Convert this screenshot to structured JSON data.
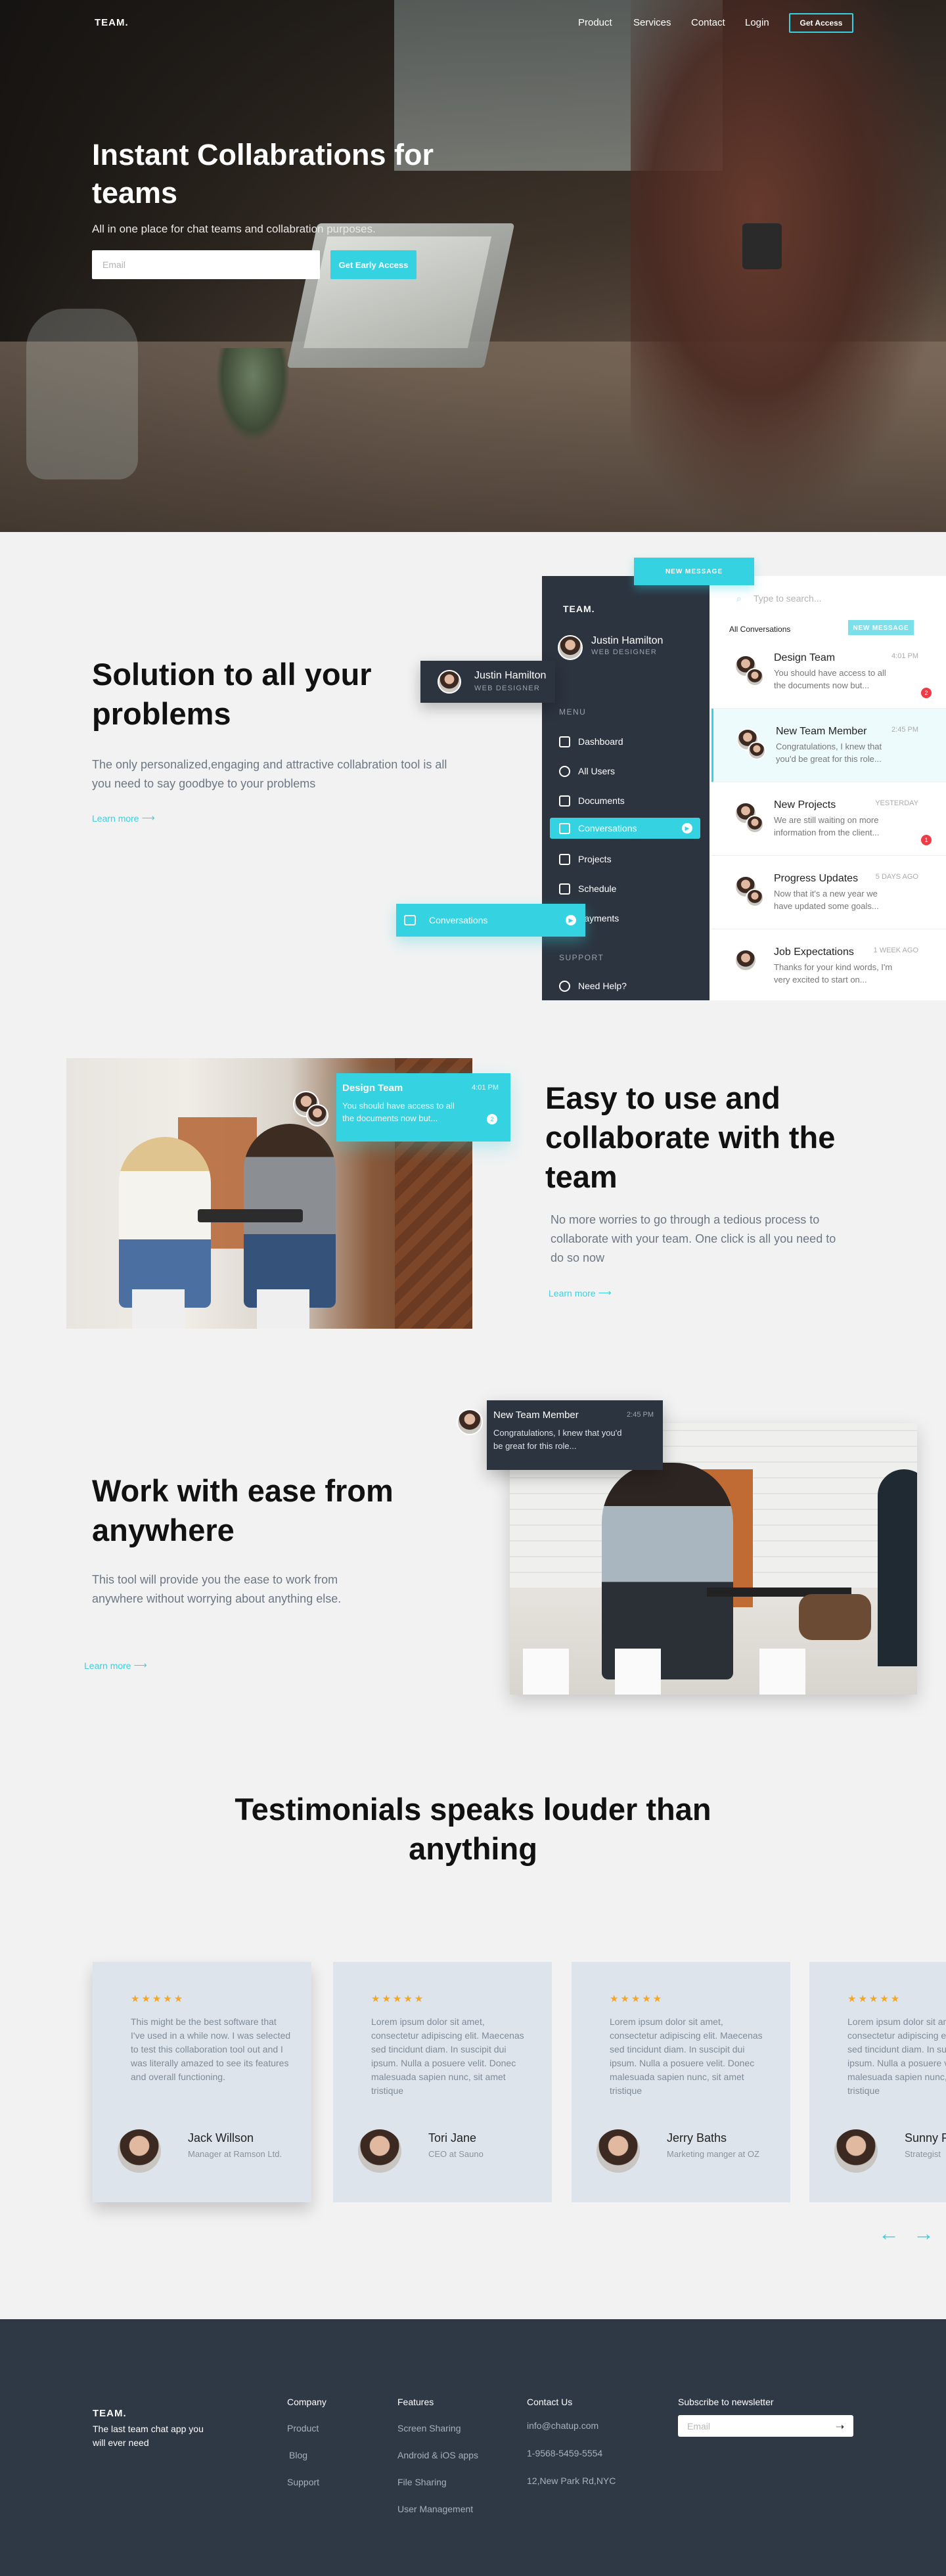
{
  "nav": {
    "logo": "TEAM.",
    "items": [
      "Product",
      "Services",
      "Contact",
      "Login"
    ],
    "cta": "Get Access"
  },
  "hero": {
    "title": "Instant Collabrations for teams",
    "subtitle": "All in one place for chat teams and collabration purposes.",
    "email_placeholder": "Email",
    "cta": "Get Early Access"
  },
  "solution": {
    "title": "Solution to all your problems",
    "text": "The only personalized,engaging and attractive collabration tool is all you need to say  goodbye to your problems",
    "learn_more": "Learn more",
    "new_message_button": "NEW MESSAGE",
    "floating_user": {
      "name": "Justin Hamilton",
      "role": "WEB DESIGNER"
    },
    "floating_conversations": "Conversations",
    "app": {
      "logo": "TEAM.",
      "user": {
        "name": "Justin Hamilton",
        "role": "WEB DESIGNER"
      },
      "menu_heading": "MENU",
      "menu": [
        "Dashboard",
        "All Users",
        "Documents",
        "Conversations",
        "Projects",
        "Schedule",
        "Payments"
      ],
      "support_heading": "SUPPORT",
      "support": [
        "Need Help?"
      ],
      "search_placeholder": "Type to search...",
      "tab_all": "All Conversations",
      "tab_new": "NEW MESSAGE",
      "conversations": [
        {
          "title": "Design Team",
          "time": "4:01 PM",
          "message": "You should have access to all the documents now but...",
          "badge": "2"
        },
        {
          "title": "New Team Member",
          "time": "2:45 PM",
          "message": "Congratulations, I knew that you'd be great for this role...",
          "badge": ""
        },
        {
          "title": "New Projects",
          "time": "YESTERDAY",
          "message": "We are still waiting on more information from the client...",
          "badge": "1"
        },
        {
          "title": "Progress Updates",
          "time": "5 DAYS AGO",
          "message": "Now that it's a new year we have updated some goals...",
          "badge": ""
        },
        {
          "title": "Job Expectations",
          "time": "1 WEEK AGO",
          "message": "Thanks for your kind words, I'm very excited to start on...",
          "badge": ""
        }
      ]
    }
  },
  "easy": {
    "title": "Easy to use and collaborate with the team",
    "text": "No more worries to go through a tedious process to collaborate with your team. One click is all you need to do so now",
    "learn_more": "Learn more",
    "chat": {
      "title": "Design Team",
      "time": "4:01 PM",
      "message": "You should have access to all the documents now but...",
      "badge": "2"
    }
  },
  "anywhere": {
    "title": "Work with ease from anywhere",
    "text": "This tool will provide you the ease to work from anywhere without worrying about anything else.",
    "learn_more": "Learn more",
    "chat": {
      "title": "New Team Member",
      "time": "2:45 PM",
      "message": "Congratulations, I knew that you'd be great for this role..."
    }
  },
  "testimonials": {
    "title": "Testimonials speaks louder than anything",
    "stars": "★★★★★",
    "items": [
      {
        "quote": "This might be the best software that I've used in a while now. I was selected to test this collaboration tool out and I was literally amazed to see its features and overall functioning.",
        "name": "Jack Willson",
        "role": "Manager at Ramson Ltd."
      },
      {
        "quote": "Lorem ipsum dolor sit amet, consectetur adipiscing elit. Maecenas sed tincidunt diam. In suscipit dui ipsum. Nulla a posuere velit. Donec malesuada sapien nunc, sit amet tristique",
        "name": "Tori Jane",
        "role": "CEO at Sauno"
      },
      {
        "quote": "Lorem ipsum dolor sit amet, consectetur adipiscing elit. Maecenas sed tincidunt diam. In suscipit dui ipsum. Nulla a posuere velit. Donec malesuada sapien nunc, sit amet tristique",
        "name": "Jerry Baths",
        "role": "Marketing manger at OZ"
      },
      {
        "quote": "Lorem ipsum dolor sit amet, consectetur adipiscing elit. Maecenas sed tincidunt diam. In suscipit dui ipsum. Nulla a posuere velit. Donec malesuada sapien nunc, sit amet tristique",
        "name": "Sunny P",
        "role": "Strategist"
      }
    ],
    "prev": "←",
    "next": "→"
  },
  "footer": {
    "logo": "TEAM.",
    "tagline": "The last team chat app you will ever need",
    "company": {
      "heading": "Company",
      "links": [
        "Product",
        "Blog",
        "Support"
      ]
    },
    "features": {
      "heading": "Features",
      "links": [
        "Screen Sharing",
        "Android & iOS apps",
        "File Sharing",
        "User Management"
      ]
    },
    "contact": {
      "heading": "Contact Us",
      "links": [
        "info@chatup.com",
        "1-9568-5459-5554",
        "12,New Park Rd,NYC"
      ]
    },
    "newsletter": {
      "heading": "Subscribe to newsletter",
      "placeholder": "Email"
    }
  },
  "colors": {
    "accent": "#35d3e2",
    "dark": "#2c3440",
    "footer": "#2f3845",
    "card": "#dde4ec",
    "star": "#f5a623",
    "badge": "#ef3b45"
  }
}
